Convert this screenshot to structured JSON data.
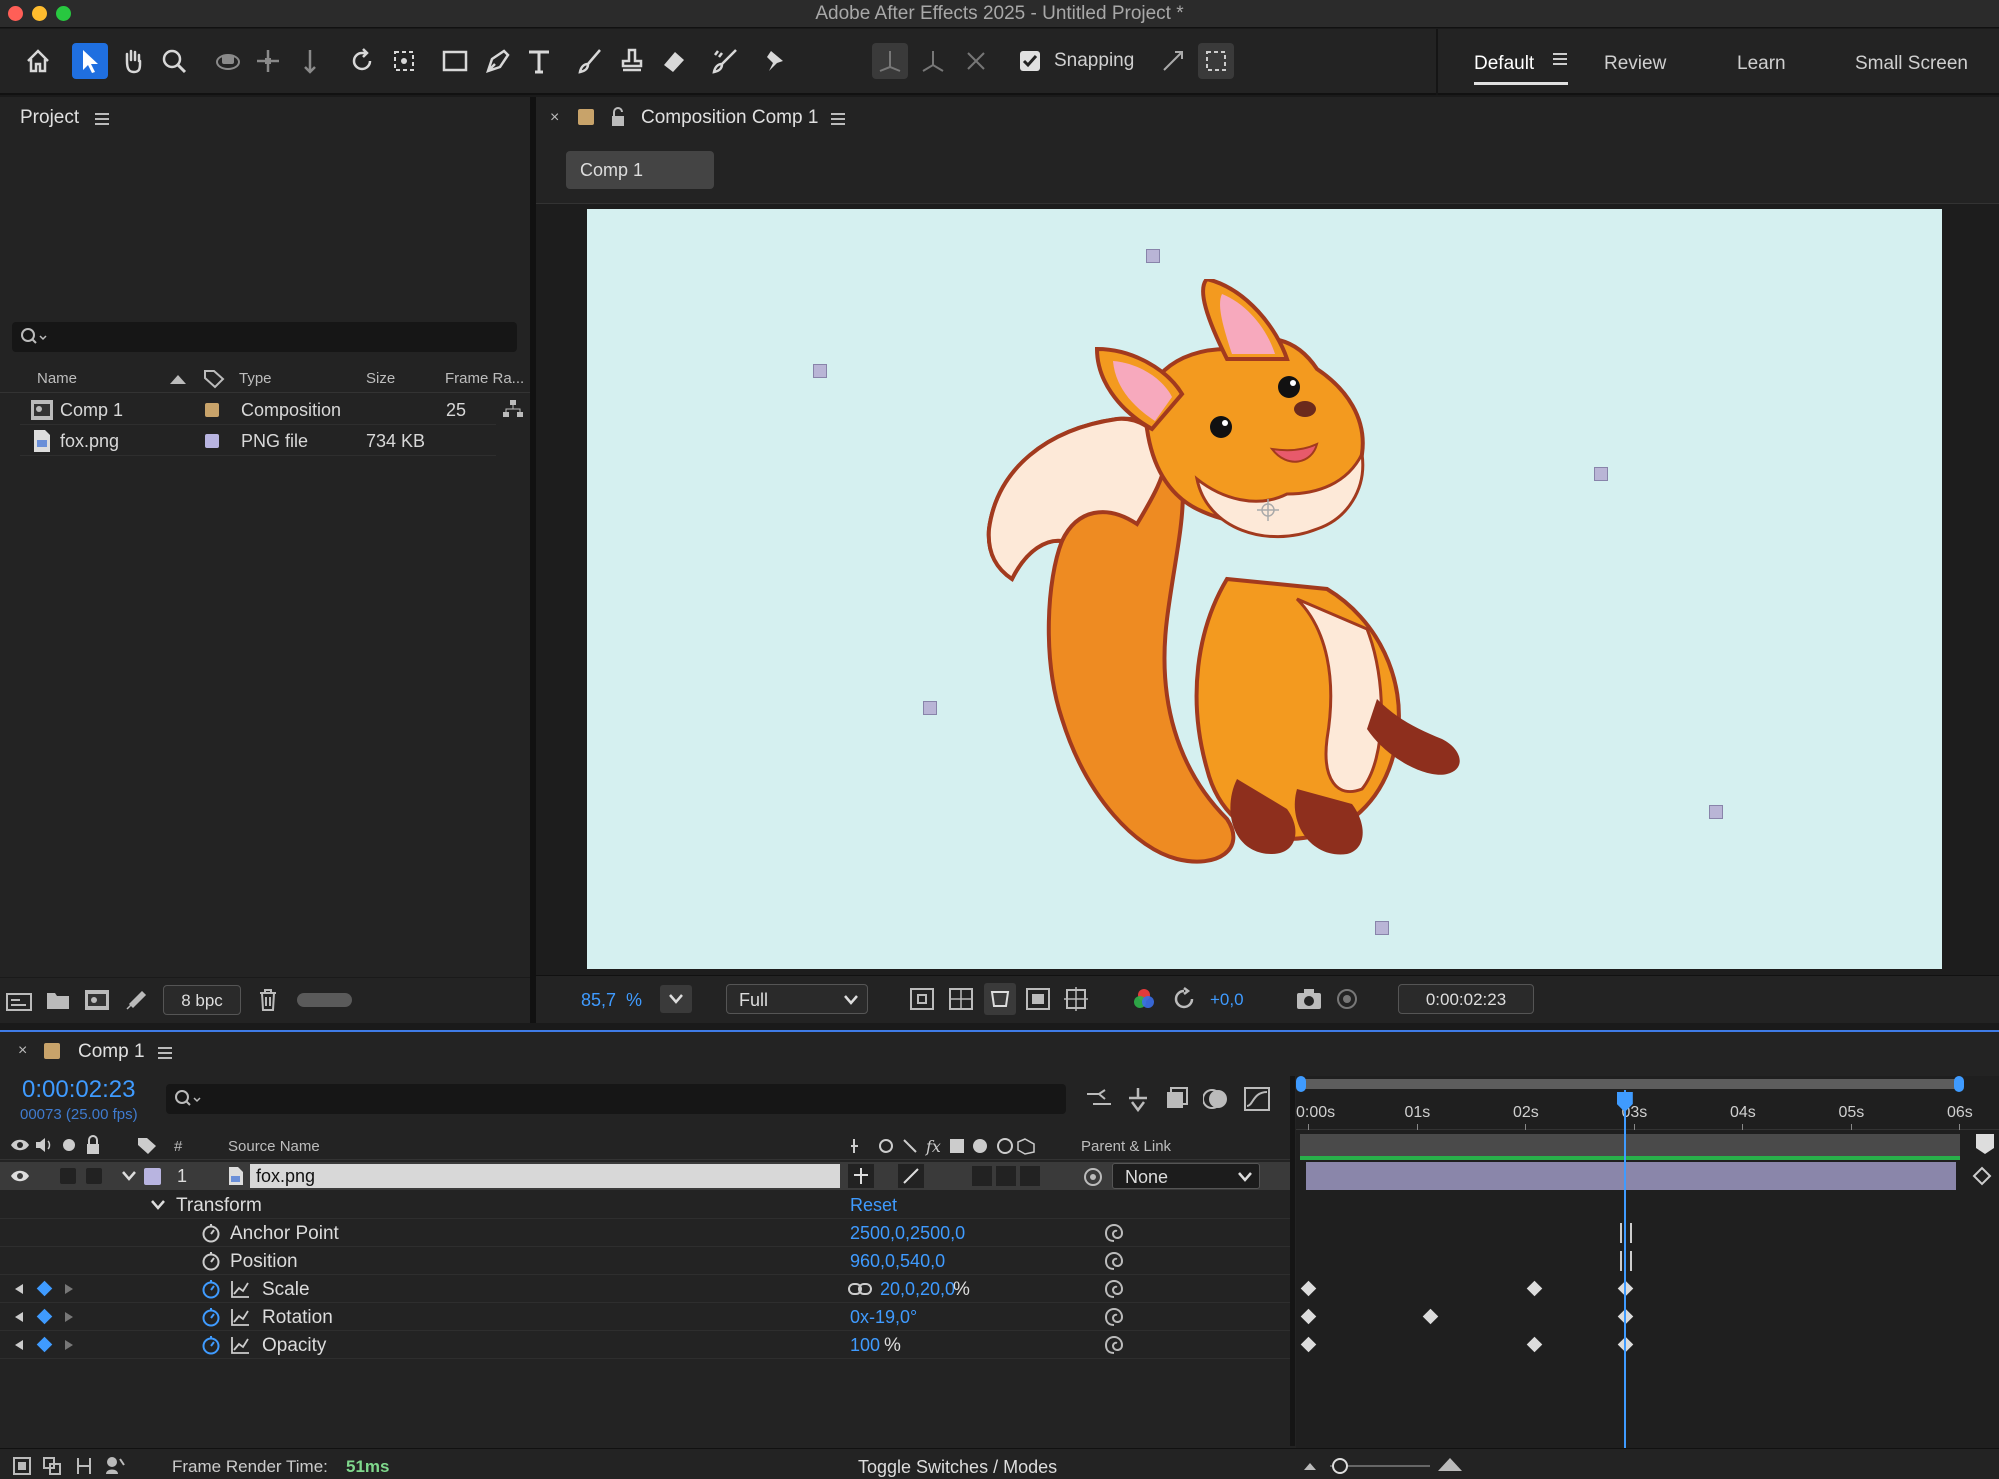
{
  "window": {
    "title": "Adobe After Effects 2025 - Untitled Project *"
  },
  "toolbar": {
    "tools": [
      "home-icon",
      "selection-icon",
      "hand-icon",
      "zoom-icon",
      "orbit-camera-icon",
      "pan-camera-icon",
      "dolly-camera-icon",
      "rotate-icon",
      "pan-behind-icon",
      "rectangle-icon",
      "pen-icon",
      "type-icon",
      "brush-icon",
      "clone-stamp-icon",
      "eraser-icon",
      "roto-brush-icon",
      "puppet-pin-icon"
    ],
    "snapping_label": "Snapping",
    "snapping_checked": true
  },
  "workspaces": {
    "items": [
      "Default",
      "Review",
      "Learn",
      "Small Screen"
    ],
    "active": "Default"
  },
  "project": {
    "title": "Project",
    "search_placeholder": "",
    "columns": {
      "name": "Name",
      "type": "Type",
      "size": "Size",
      "frame_rate": "Frame Ra..."
    },
    "items": [
      {
        "name": "Comp 1",
        "type": "Composition",
        "size": "",
        "frame_rate": "25",
        "label_color": "#c8a36a"
      },
      {
        "name": "fox.png",
        "type": "PNG file",
        "size": "734 KB",
        "frame_rate": "",
        "label_color": "#b8b4e0"
      }
    ],
    "footer": {
      "bpc": "8 bpc"
    }
  },
  "composition": {
    "panel_title": "Composition Comp 1",
    "tab_label": "Comp 1",
    "background_color": "#d5f0f0",
    "zoom_value": "85,7",
    "zoom_unit": "%",
    "resolution": "Full",
    "exposure": "+0,0",
    "timecode": "0:00:02:23"
  },
  "timeline": {
    "panel_title": "Comp 1",
    "timecode": "0:00:02:23",
    "frame_info": "00073 (25.00 fps)",
    "ruler": [
      "0:00s",
      "01s",
      "02s",
      "03s",
      "04s",
      "05s",
      "06s"
    ],
    "playhead_seconds": 2.92,
    "headers": {
      "index": "#",
      "source_name": "Source Name",
      "parent_link": "Parent & Link"
    },
    "layer": {
      "index": "1",
      "name": "fox.png",
      "parent": "None",
      "label_color": "#b8b4e0"
    },
    "transform": {
      "label": "Transform",
      "reset": "Reset"
    },
    "properties": [
      {
        "name": "Anchor Point",
        "value": "2500,0,2500,0",
        "unit": "",
        "keyframes": []
      },
      {
        "name": "Position",
        "value": "960,0,540,0",
        "unit": "",
        "keyframes": []
      },
      {
        "name": "Scale",
        "value": "20,0,20,0",
        "unit": "%",
        "keyframes": [
          0,
          2.08,
          2.92
        ]
      },
      {
        "name": "Rotation",
        "value": "0x-19,0",
        "unit": "°",
        "keyframes": [
          0,
          1.12,
          2.92
        ]
      },
      {
        "name": "Opacity",
        "value": "100",
        "unit": "%",
        "keyframes": [
          0,
          2.08,
          2.92
        ]
      }
    ],
    "footer": {
      "render_label": "Frame Render Time:",
      "render_value": "51ms",
      "toggle": "Toggle Switches / Modes"
    }
  }
}
